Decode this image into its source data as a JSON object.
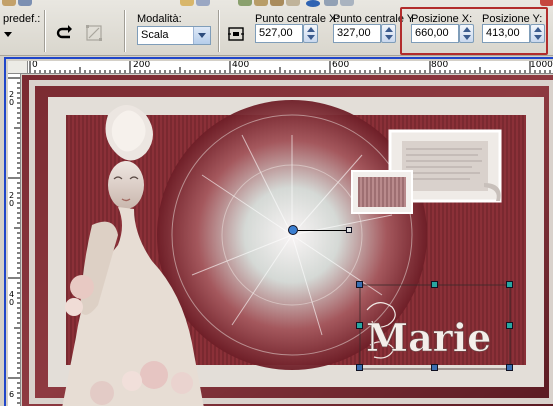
{
  "toolbar": {
    "preset_label": "predef.:",
    "mode_label": "Modalità:",
    "mode_value": "Scala",
    "center_x_label": "Punto centrale X:",
    "center_x_value": "527,00",
    "center_y_label": "Punto centrale Y",
    "center_y_value": "327,00",
    "pos_x_label": "Posizione X:",
    "pos_x_value": "660,00",
    "pos_y_label": "Posizione Y:",
    "pos_y_value": "413,00"
  },
  "ruler": {
    "h_ticks": [
      "0",
      "200",
      "400",
      "600",
      "800",
      "1000"
    ],
    "v_ticks": [
      "2",
      "0",
      "2",
      "0",
      "4",
      "0",
      "6"
    ]
  },
  "canvas": {
    "wordart_text": "Marie"
  },
  "colors": {
    "highlight": "#b22c2c",
    "frame_border": "#2046c9",
    "handle": "#3a6fb1"
  }
}
